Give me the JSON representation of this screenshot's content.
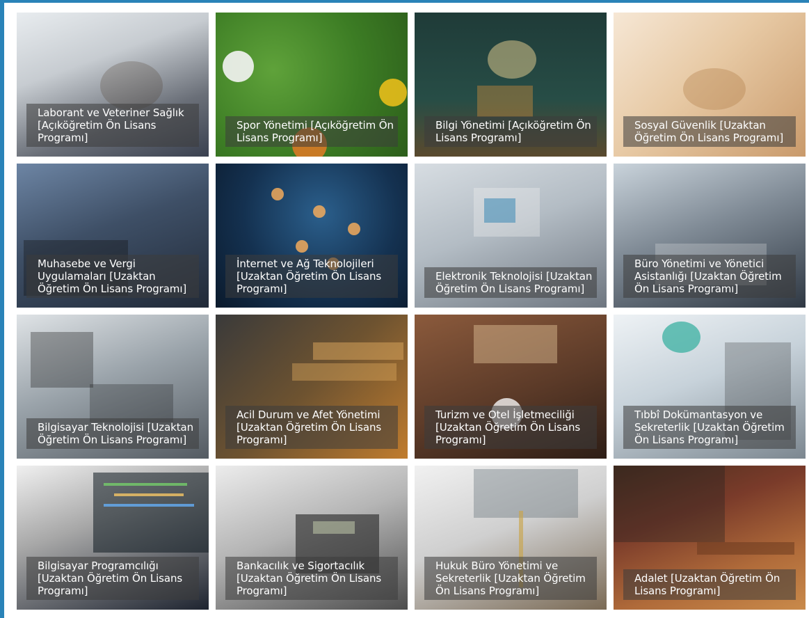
{
  "programs": [
    {
      "title": "Laborant ve Veteriner Sağlık [Açıköğretim Ön Lisans Programı]",
      "icon": "veterinary-icon"
    },
    {
      "title": "Spor Yönetimi [Açıköğretim Ön Lisans Programı]",
      "icon": "sports-icon"
    },
    {
      "title": "Bilgi Yönetimi [Açıköğretim Ön Lisans Programı]",
      "icon": "knowledge-icon"
    },
    {
      "title": "Sosyal Güvenlik [Uzaktan Öğretim Ön Lisans Programı]",
      "icon": "social-security-icon"
    },
    {
      "title": "Muhasebe ve Vergi Uygulamaları [Uzaktan Öğretim Ön Lisans Programı]",
      "icon": "accounting-icon"
    },
    {
      "title": "İnternet ve Ağ Teknolojileri [Uzaktan Öğretim Ön Lisans Programı]",
      "icon": "network-icon"
    },
    {
      "title": "Elektronik Teknolojisi [Uzaktan Öğretim Ön Lisans Programı]",
      "icon": "electronics-icon"
    },
    {
      "title": "Büro Yönetimi ve Yönetici Asistanlığı [Uzaktan Öğretim Ön Lisans Programı]",
      "icon": "office-icon"
    },
    {
      "title": "Bilgisayar Teknolojisi [Uzaktan Öğretim Ön Lisans Programı]",
      "icon": "computer-icon"
    },
    {
      "title": "Acil Durum ve Afet Yönetimi [Uzaktan Öğretim Ön Lisans Programı]",
      "icon": "emergency-icon"
    },
    {
      "title": "Turizm ve Otel İşletmeciliği [Uzaktan Öğretim Ön Lisans Programı]",
      "icon": "tourism-icon"
    },
    {
      "title": "Tıbbî Dokümantasyon ve Sekreterlik [Uzaktan Öğretim Ön Lisans Programı]",
      "icon": "medical-icon"
    },
    {
      "title": "Bilgisayar Programcılığı [Uzaktan Öğretim Ön Lisans Programı]",
      "icon": "programming-icon"
    },
    {
      "title": "Bankacılık ve Sigortacılık [Uzaktan Öğretim Ön Lisans Programı]",
      "icon": "banking-icon"
    },
    {
      "title": "Hukuk Büro Yönetimi ve Sekreterlik [Uzaktan Öğretim Ön Lisans Programı]",
      "icon": "law-icon"
    },
    {
      "title": "Adalet [Uzaktan Öğretim Ön Lisans Programı]",
      "icon": "justice-icon"
    }
  ],
  "colors": {
    "accent": "#2a83b8",
    "caption_bg": "rgba(60,60,60,0.55)",
    "caption_text": "#ffffff"
  }
}
